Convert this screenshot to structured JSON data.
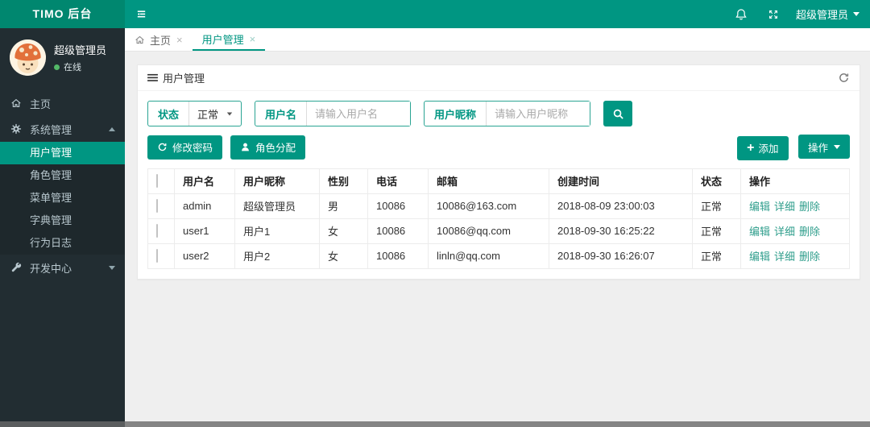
{
  "colors": {
    "teal": "#009682",
    "brand_bg": "#00876f",
    "sidebar_bg": "#222d32",
    "submenu_bg": "#1e282c",
    "content_bg": "#efefef",
    "online_green": "#54b968",
    "link_teal": "#2f9e8c"
  },
  "topbar": {
    "brand": "TIMO 后台",
    "user_menu": "超级管理员"
  },
  "user_panel": {
    "name": "超级管理员",
    "status": "在线"
  },
  "sidebar": {
    "home": "主页",
    "system": "系统管理",
    "system_children": [
      "用户管理",
      "角色管理",
      "菜单管理",
      "字典管理",
      "行为日志"
    ],
    "dev": "开发中心"
  },
  "tabs": {
    "home": "主页",
    "user_management": "用户管理"
  },
  "panel": {
    "title": "用户管理"
  },
  "filters": {
    "status_label": "状态",
    "status_value": "正常",
    "username_label": "用户名",
    "username_placeholder": "请输入用户名",
    "nickname_label": "用户昵称",
    "nickname_placeholder": "请输入用户昵称"
  },
  "toolbar": {
    "change_password": "修改密码",
    "assign_roles": "角色分配",
    "add": "添加",
    "actions": "操作"
  },
  "table": {
    "headers": [
      "用户名",
      "用户昵称",
      "性别",
      "电话",
      "邮箱",
      "创建时间",
      "状态",
      "操作"
    ],
    "rows": [
      {
        "username": "admin",
        "nickname": "超级管理员",
        "gender": "男",
        "phone": "10086",
        "email": "10086@163.com",
        "created": "2018-08-09 23:00:03",
        "status": "正常"
      },
      {
        "username": "user1",
        "nickname": "用户1",
        "gender": "女",
        "phone": "10086",
        "email": "10086@qq.com",
        "created": "2018-09-30 16:25:22",
        "status": "正常"
      },
      {
        "username": "user2",
        "nickname": "用户2",
        "gender": "女",
        "phone": "10086",
        "email": "linln@qq.com",
        "created": "2018-09-30 16:26:07",
        "status": "正常"
      }
    ],
    "row_actions": [
      "编辑",
      "详细",
      "删除"
    ]
  },
  "icons": {
    "sidebar-toggle": "three-bars",
    "bell": "notification-bell",
    "fullscreen": "expand-arrows",
    "home": "house-outline",
    "gear": "cog",
    "wrench": "wrench",
    "list": "three-lines",
    "refresh": "circular-arrow",
    "user": "person-silhouette",
    "search": "magnifier",
    "plus": "+",
    "caret": "triangle"
  }
}
